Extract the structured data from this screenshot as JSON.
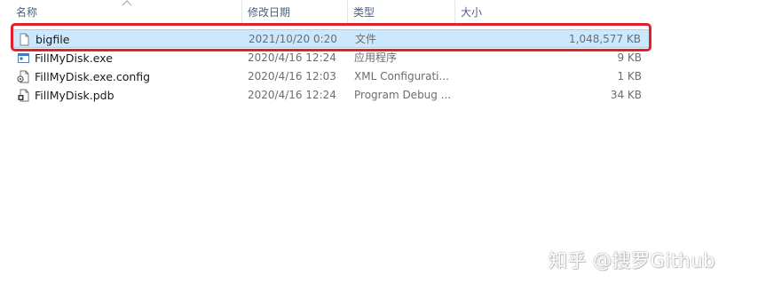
{
  "columns": {
    "name": "名称",
    "date": "修改日期",
    "type": "类型",
    "size": "大小"
  },
  "files": [
    {
      "name": "bigfile",
      "date": "2021/10/20 0:20",
      "type": "文件",
      "size": "1,048,577 KB",
      "icon": "blank-file-icon",
      "selected": true
    },
    {
      "name": "FillMyDisk.exe",
      "date": "2020/4/16 12:24",
      "type": "应用程序",
      "size": "9 KB",
      "icon": "application-icon",
      "selected": false
    },
    {
      "name": "FillMyDisk.exe.config",
      "date": "2020/4/16 12:03",
      "type": "XML Configurati...",
      "size": "1 KB",
      "icon": "config-file-icon",
      "selected": false
    },
    {
      "name": "FillMyDisk.pdb",
      "date": "2020/4/16 12:24",
      "type": "Program Debug ...",
      "size": "34 KB",
      "icon": "debug-file-icon",
      "selected": false
    }
  ],
  "watermark": "知乎 @搜罗Github",
  "colors": {
    "selection_bg": "#cce8ff",
    "highlight_border": "#e0212b",
    "header_text": "#4c607a"
  }
}
